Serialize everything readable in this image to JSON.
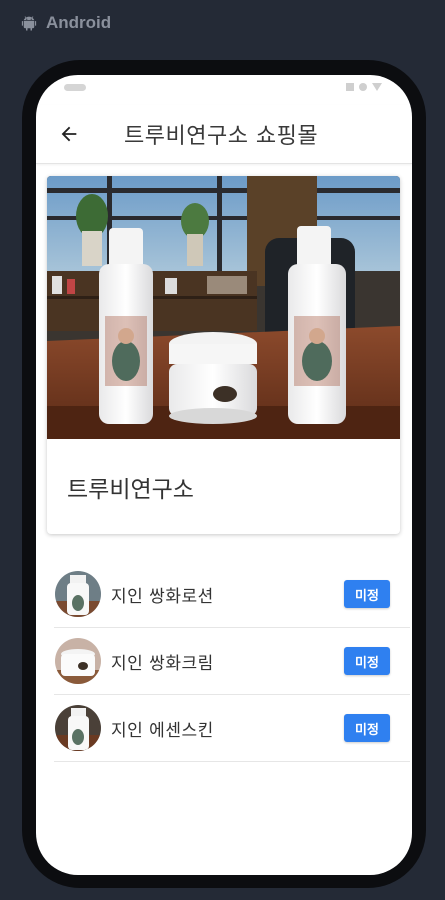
{
  "platform": {
    "label": "Android",
    "icon": "android-icon"
  },
  "app_bar": {
    "back_icon": "arrow-left-icon",
    "title": "트루비연구소 쇼핑몰"
  },
  "store": {
    "name": "트루비연구소",
    "image": "store-product-photo"
  },
  "products": [
    {
      "name": "지인 쌍화로션",
      "status": "미정",
      "thumbnail": "lotion-thumbnail"
    },
    {
      "name": "지인 쌍화크림",
      "status": "미정",
      "thumbnail": "cream-thumbnail"
    },
    {
      "name": "지인 에센스킨",
      "status": "미정",
      "thumbnail": "essence-thumbnail"
    }
  ],
  "colors": {
    "background": "#242a36",
    "badge": "#2f80f0",
    "phone_frame": "#0c0d10"
  }
}
